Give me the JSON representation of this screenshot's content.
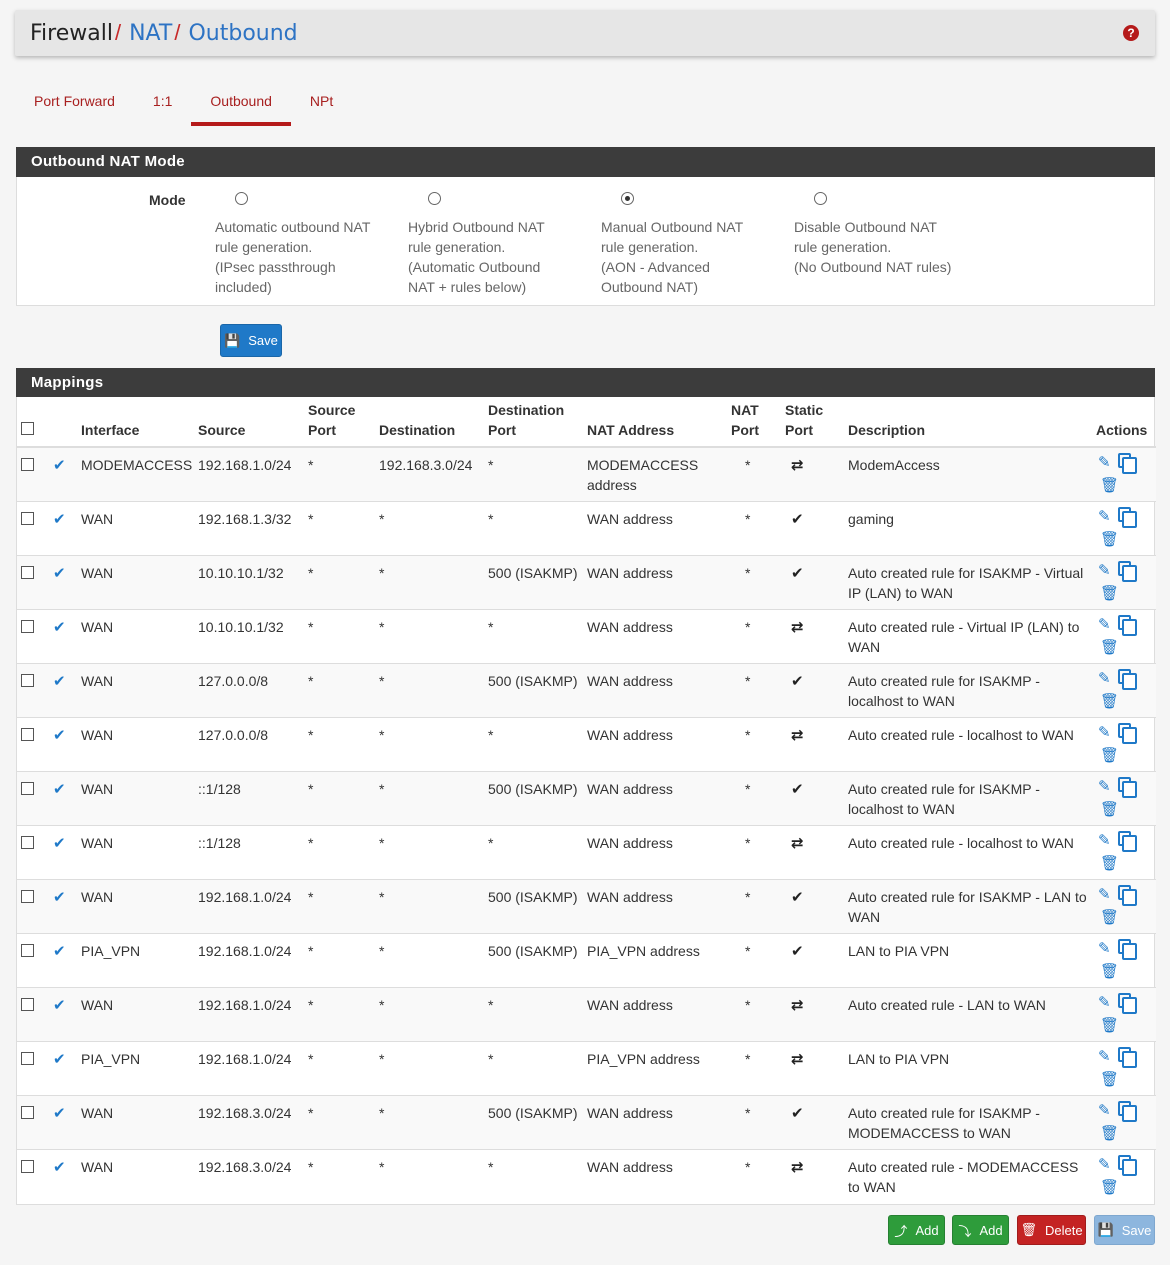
{
  "breadcrumb": {
    "root": "Firewall",
    "level1": "NAT",
    "level2": "Outbound",
    "sep": "/"
  },
  "help_icon": "question-circle-icon",
  "tabs": [
    {
      "label": "Port Forward"
    },
    {
      "label": "1:1"
    },
    {
      "label": "Outbound",
      "active": true
    },
    {
      "label": "NPt"
    }
  ],
  "mode_panel": {
    "title": "Outbound NAT Mode",
    "label": "Mode",
    "options": [
      {
        "text": "Automatic outbound NAT rule generation. (IPsec passthrough included)",
        "lines": [
          "Automatic outbound NAT",
          "rule generation.",
          "(IPsec passthrough",
          "included)"
        ],
        "checked": false
      },
      {
        "text": "Hybrid Outbound NAT rule generation. (Automatic Outbound NAT + rules below)",
        "lines": [
          "Hybrid Outbound NAT",
          "rule generation.",
          "(Automatic Outbound",
          "NAT + rules below)"
        ],
        "checked": false
      },
      {
        "text": "Manual Outbound NAT rule generation. (AON - Advanced Outbound NAT)",
        "lines": [
          "Manual Outbound NAT",
          "rule generation.",
          "(AON - Advanced",
          "Outbound NAT)"
        ],
        "checked": true
      },
      {
        "text": "Disable Outbound NAT rule generation. (No Outbound NAT rules)",
        "lines": [
          "Disable Outbound NAT",
          "rule generation.",
          "(No Outbound NAT rules)"
        ],
        "checked": false
      }
    ],
    "save_label": "Save"
  },
  "mappings": {
    "title": "Mappings",
    "columns": {
      "interface": "Interface",
      "source": "Source",
      "source_port_1": "Source",
      "source_port_2": "Port",
      "destination": "Destination",
      "dest_port_1": "Destination",
      "dest_port_2": "Port",
      "nat_address": "NAT Address",
      "nat_port_1": "NAT",
      "nat_port_2": "Port",
      "static_port_1": "Static",
      "static_port_2": "Port",
      "description": "Description",
      "actions": "Actions"
    },
    "rows": [
      {
        "interface": "MODEMACCESS",
        "source": "192.168.1.0/24",
        "source_port": "*",
        "destination": "192.168.3.0/24",
        "dest_port": "*",
        "nat_address": "MODEMACCESS address",
        "nat_port": "*",
        "static": "random",
        "description": "ModemAccess"
      },
      {
        "interface": "WAN",
        "source": "192.168.1.3/32",
        "source_port": "*",
        "destination": "*",
        "dest_port": "*",
        "nat_address": "WAN address",
        "nat_port": "*",
        "static": "check",
        "description": "gaming"
      },
      {
        "interface": "WAN",
        "source": "10.10.10.1/32",
        "source_port": "*",
        "destination": "*",
        "dest_port": "500 (ISAKMP)",
        "nat_address": "WAN address",
        "nat_port": "*",
        "static": "check",
        "description": "Auto created rule for ISAKMP - Virtual IP (LAN) to WAN"
      },
      {
        "interface": "WAN",
        "source": "10.10.10.1/32",
        "source_port": "*",
        "destination": "*",
        "dest_port": "*",
        "nat_address": "WAN address",
        "nat_port": "*",
        "static": "random",
        "description": "Auto created rule - Virtual IP (LAN) to WAN"
      },
      {
        "interface": "WAN",
        "source": "127.0.0.0/8",
        "source_port": "*",
        "destination": "*",
        "dest_port": "500 (ISAKMP)",
        "nat_address": "WAN address",
        "nat_port": "*",
        "static": "check",
        "description": "Auto created rule for ISAKMP - localhost to WAN"
      },
      {
        "interface": "WAN",
        "source": "127.0.0.0/8",
        "source_port": "*",
        "destination": "*",
        "dest_port": "*",
        "nat_address": "WAN address",
        "nat_port": "*",
        "static": "random",
        "description": "Auto created rule - localhost to WAN"
      },
      {
        "interface": "WAN",
        "source": "::1/128",
        "source_port": "*",
        "destination": "*",
        "dest_port": "500 (ISAKMP)",
        "nat_address": "WAN address",
        "nat_port": "*",
        "static": "check",
        "description": "Auto created rule for ISAKMP - localhost to WAN"
      },
      {
        "interface": "WAN",
        "source": "::1/128",
        "source_port": "*",
        "destination": "*",
        "dest_port": "*",
        "nat_address": "WAN address",
        "nat_port": "*",
        "static": "random",
        "description": "Auto created rule - localhost to WAN"
      },
      {
        "interface": "WAN",
        "source": "192.168.1.0/24",
        "source_port": "*",
        "destination": "*",
        "dest_port": "500 (ISAKMP)",
        "nat_address": "WAN address",
        "nat_port": "*",
        "static": "check",
        "description": "Auto created rule for ISAKMP - LAN to WAN"
      },
      {
        "interface": "PIA_VPN",
        "source": "192.168.1.0/24",
        "source_port": "*",
        "destination": "*",
        "dest_port": "500 (ISAKMP)",
        "nat_address": "PIA_VPN address",
        "nat_port": "*",
        "static": "check",
        "description": "LAN to PIA VPN"
      },
      {
        "interface": "WAN",
        "source": "192.168.1.0/24",
        "source_port": "*",
        "destination": "*",
        "dest_port": "*",
        "nat_address": "WAN address",
        "nat_port": "*",
        "static": "random",
        "description": "Auto created rule - LAN to WAN"
      },
      {
        "interface": "PIA_VPN",
        "source": "192.168.1.0/24",
        "source_port": "*",
        "destination": "*",
        "dest_port": "*",
        "nat_address": "PIA_VPN address",
        "nat_port": "*",
        "static": "random",
        "description": "LAN to PIA VPN"
      },
      {
        "interface": "WAN",
        "source": "192.168.3.0/24",
        "source_port": "*",
        "destination": "*",
        "dest_port": "500 (ISAKMP)",
        "nat_address": "WAN address",
        "nat_port": "*",
        "static": "check",
        "description": "Auto created rule for ISAKMP - MODEMACCESS to WAN"
      },
      {
        "interface": "WAN",
        "source": "192.168.3.0/24",
        "source_port": "*",
        "destination": "*",
        "dest_port": "*",
        "nat_address": "WAN address",
        "nat_port": "*",
        "static": "random",
        "description": "Auto created rule - MODEMACCESS to WAN"
      }
    ]
  },
  "footer_buttons": {
    "add_top": "Add",
    "add_bottom": "Add",
    "delete": "Delete",
    "save": "Save"
  }
}
